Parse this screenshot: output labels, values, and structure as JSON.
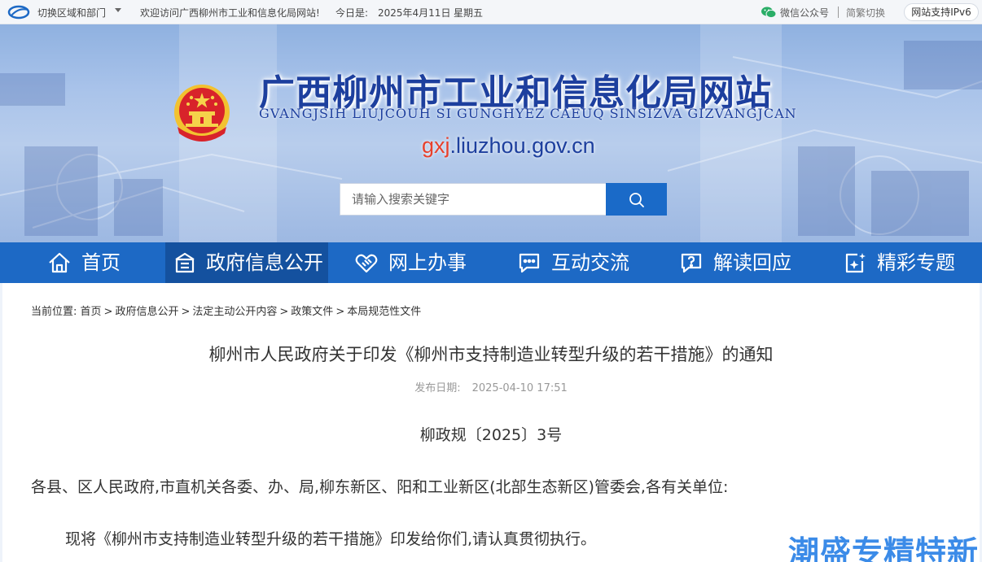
{
  "topbar": {
    "region_label": "切换区域和部门",
    "welcome": "欢迎访问广西柳州市工业和信息化局网站!",
    "today_label": "今日是:",
    "date": "2025年4月11日",
    "weekday": "星期五",
    "wechat_label": "微信公众号",
    "traditional_label": "简繁切换",
    "ipv6_label": "网站支持IPv6"
  },
  "banner": {
    "title": "广西柳州市工业和信息化局网站",
    "subtitle": "GVANGJSIH LIUJCOUH SI GUNGHYEZ CAEUQ SINSIZVA GIZVANGJCAN",
    "domain_prefix": "gxj",
    "domain_rest": ".liuzhou.gov.cn"
  },
  "search": {
    "placeholder": "请输入搜索关键字",
    "value": ""
  },
  "nav": {
    "items": [
      {
        "label": "首页",
        "icon": "home-icon"
      },
      {
        "label": "政府信息公开",
        "icon": "building-icon",
        "active": true
      },
      {
        "label": "网上办事",
        "icon": "handshake-icon"
      },
      {
        "label": "互动交流",
        "icon": "chat-icon"
      },
      {
        "label": "解读回应",
        "icon": "question-chat-icon"
      },
      {
        "label": "精彩专题",
        "icon": "sparkle-icon"
      }
    ]
  },
  "breadcrumb": {
    "prefix": "当前位置:",
    "items": [
      "首页",
      "政府信息公开",
      "法定主动公开内容",
      "政策文件",
      "本局规范性文件"
    ]
  },
  "article": {
    "title": "柳州市人民政府关于印发《柳州市支持制造业转型升级的若干措施》的通知",
    "publish_label": "发布日期:",
    "publish_date": "2025-04-10 17:51",
    "doc_number": "柳政规〔2025〕3号",
    "addressee": "各县、区人民政府,市直机关各委、办、局,柳东新区、阳和工业新区(北部生态新区)管委会,各有关单位:",
    "body": "现将《柳州市支持制造业转型升级的若干措施》印发给你们,请认真贯彻执行。"
  },
  "watermark": "潮盛专精特新",
  "colors": {
    "nav_bg": "#1d69c5",
    "nav_active_bg": "#14519f",
    "title_blue": "#1d3f9e",
    "domain_red": "#e8402b",
    "search_btn": "#1a6ac8"
  }
}
